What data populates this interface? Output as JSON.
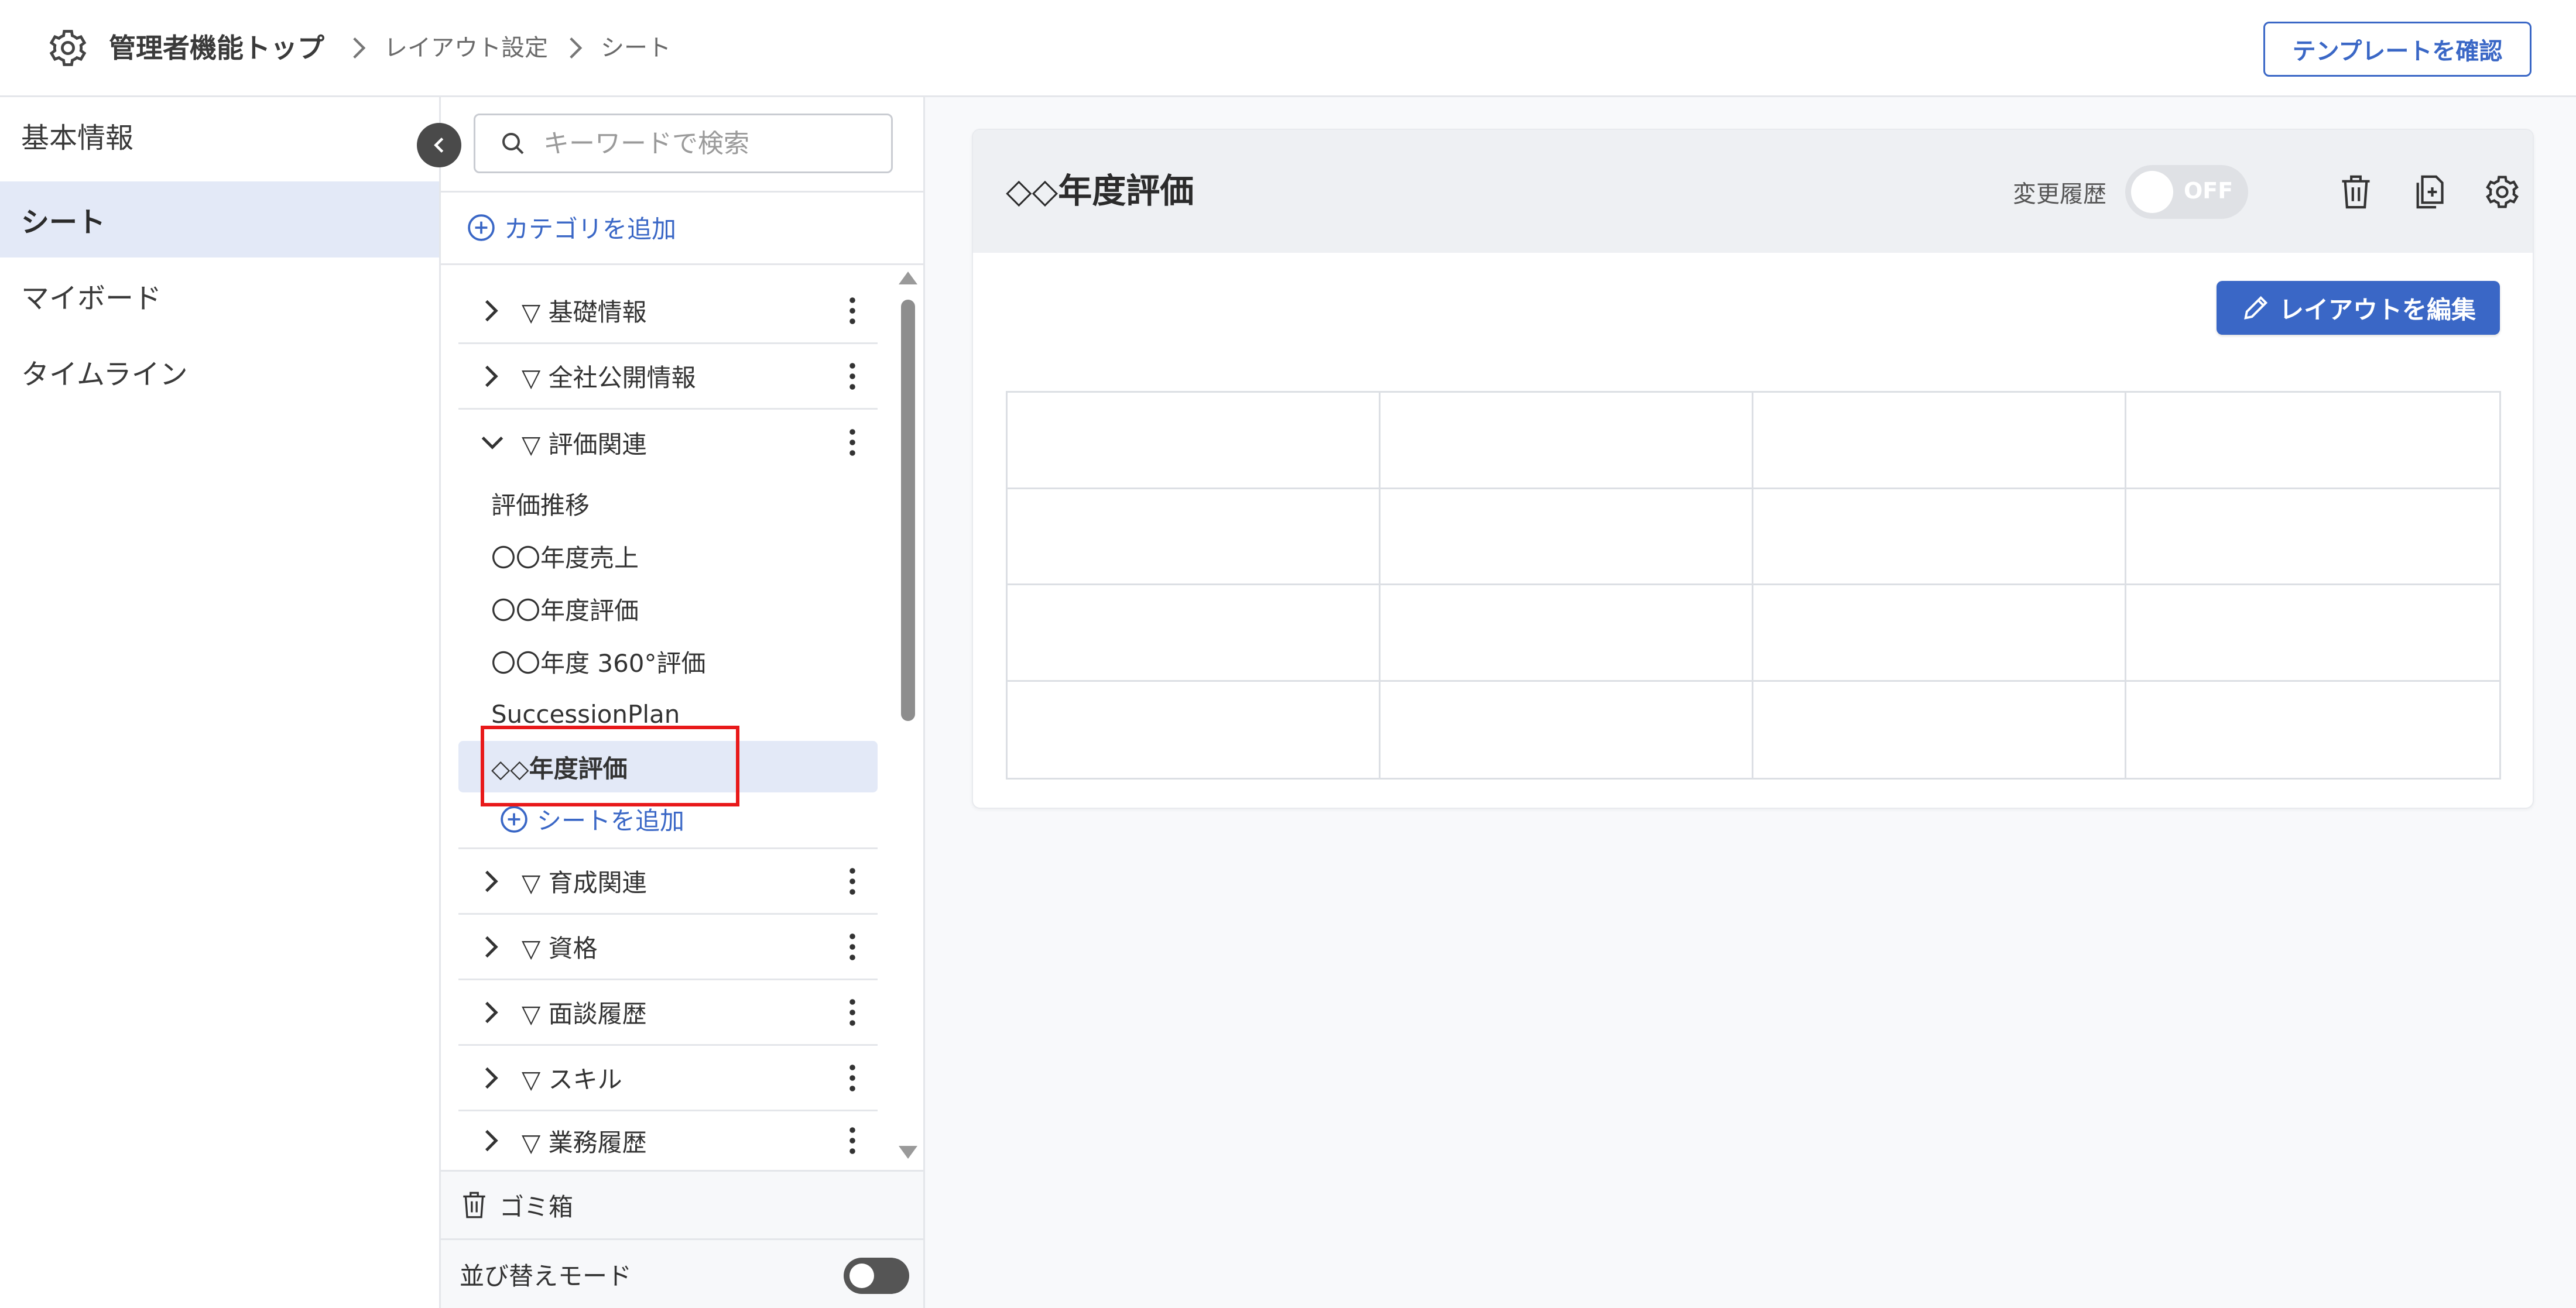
{
  "header": {
    "breadcrumb": [
      "管理者機能トップ",
      "レイアウト設定",
      "シート"
    ],
    "template_button": "テンプレートを確認"
  },
  "left_nav": {
    "items": [
      {
        "label": "基本情報",
        "active": false
      },
      {
        "label": "シート",
        "active": true
      },
      {
        "label": "マイボード",
        "active": false
      },
      {
        "label": "タイムライン",
        "active": false
      }
    ]
  },
  "sheet_panel": {
    "search_placeholder": "キーワードで検索",
    "add_category": "カテゴリを追加",
    "categories_before": [
      {
        "label": "▽ 基礎情報"
      },
      {
        "label": "▽ 全社公開情報"
      },
      {
        "label": "▽ 評価関連"
      }
    ],
    "expanded_sheets": [
      {
        "label": "評価推移"
      },
      {
        "label": "〇〇年度売上"
      },
      {
        "label": "〇〇年度評価"
      },
      {
        "label": "〇〇年度 360°評価"
      },
      {
        "label": "SuccessionPlan"
      },
      {
        "label": "◇◇年度評価"
      }
    ],
    "add_sheet": "シートを追加",
    "categories_after": [
      {
        "label": "▽ 育成関連"
      },
      {
        "label": "▽ 資格"
      },
      {
        "label": "▽ 面談履歴"
      },
      {
        "label": "▽ スキル"
      },
      {
        "label": "▽ 業務履歴"
      }
    ],
    "trash_label": "ゴミ箱",
    "sort_mode_label": "並び替えモード"
  },
  "main": {
    "sheet_title": "◇◇年度評価",
    "history_label": "変更履歴",
    "history_toggle": "OFF",
    "edit_layout_button": "レイアウトを編集"
  },
  "colors": {
    "accent": "#3a67c6",
    "highlight_box": "#e8191a",
    "selected_bg": "#e3e9f7"
  },
  "icons": [
    "gear-icon",
    "chevron-right-icon",
    "chevron-left-icon",
    "search-icon",
    "plus-circle-icon",
    "chevron-down-icon",
    "kebab-icon",
    "trash-icon",
    "copy-add-icon",
    "settings-icon",
    "pencil-icon"
  ]
}
